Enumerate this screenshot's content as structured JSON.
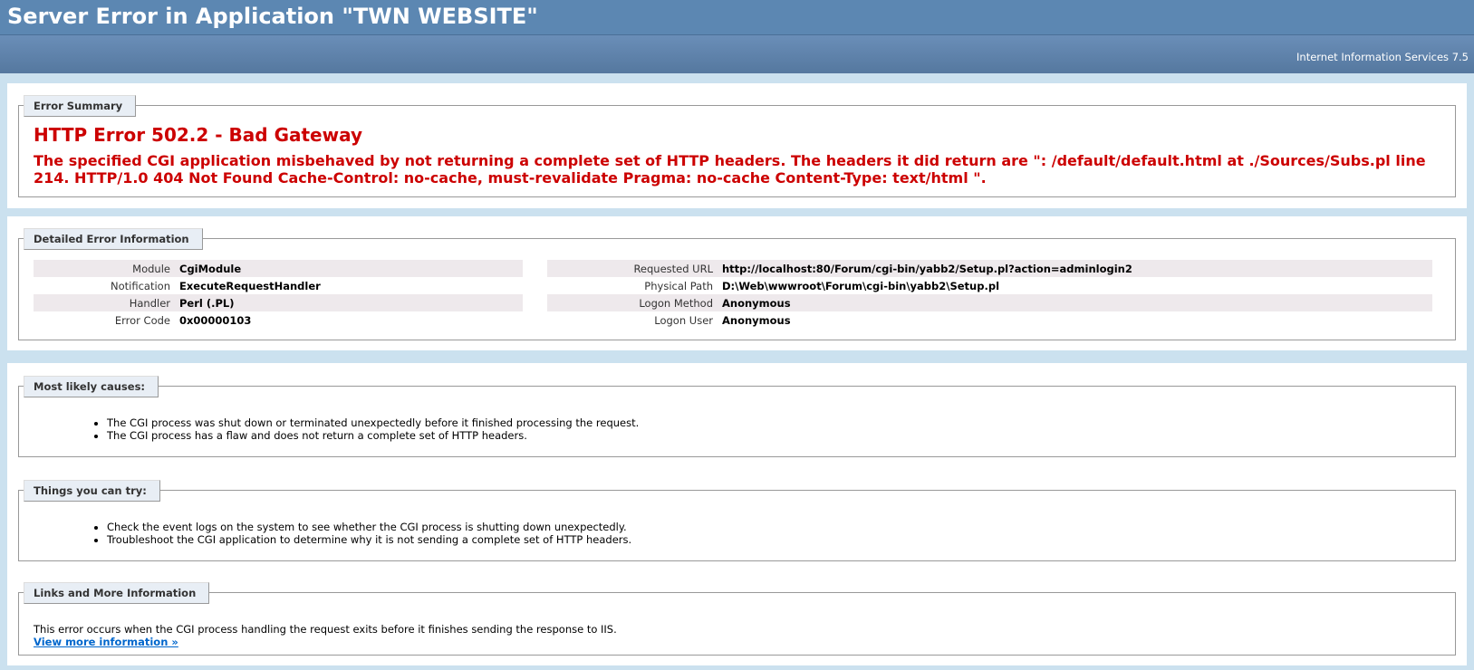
{
  "header": {
    "title": "Server Error in Application \"TWN WEBSITE\"",
    "server": "Internet Information Services 7.5"
  },
  "summary": {
    "legend": "Error Summary",
    "error_title": "HTTP Error 502.2 - Bad Gateway",
    "error_message": "The specified CGI application misbehaved by not returning a complete set of HTTP headers. The headers it did return are \": /default/default.html at ./Sources/Subs.pl line 214. HTTP/1.0 404 Not Found Cache-Control: no-cache, must-revalidate Pragma: no-cache Content-Type: text/html \"."
  },
  "detail": {
    "legend": "Detailed Error Information",
    "left": [
      {
        "label": "Module",
        "value": "CgiModule"
      },
      {
        "label": "Notification",
        "value": "ExecuteRequestHandler"
      },
      {
        "label": "Handler",
        "value": "Perl (.PL)"
      },
      {
        "label": "Error Code",
        "value": "0x00000103"
      }
    ],
    "right": [
      {
        "label": "Requested URL",
        "value": "http://localhost:80/Forum/cgi-bin/yabb2/Setup.pl?action=adminlogin2"
      },
      {
        "label": "Physical Path",
        "value": "D:\\Web\\wwwroot\\Forum\\cgi-bin\\yabb2\\Setup.pl"
      },
      {
        "label": "Logon Method",
        "value": "Anonymous"
      },
      {
        "label": "Logon User",
        "value": "Anonymous"
      }
    ]
  },
  "causes": {
    "legend": "Most likely causes:",
    "items": [
      "The CGI process was shut down or terminated unexpectedly before it finished processing the request.",
      "The CGI process has a flaw and does not return a complete set of HTTP headers."
    ]
  },
  "try": {
    "legend": "Things you can try:",
    "items": [
      "Check the event logs on the system to see whether the CGI process is shutting down unexpectedly.",
      "Troubleshoot the CGI application to determine why it is not sending a complete set of HTTP headers."
    ]
  },
  "links": {
    "legend": "Links and More Information",
    "text": "This error occurs when the CGI process handling the request exits before it finishes sending the response to IIS.",
    "link_label": "View more information »"
  }
}
